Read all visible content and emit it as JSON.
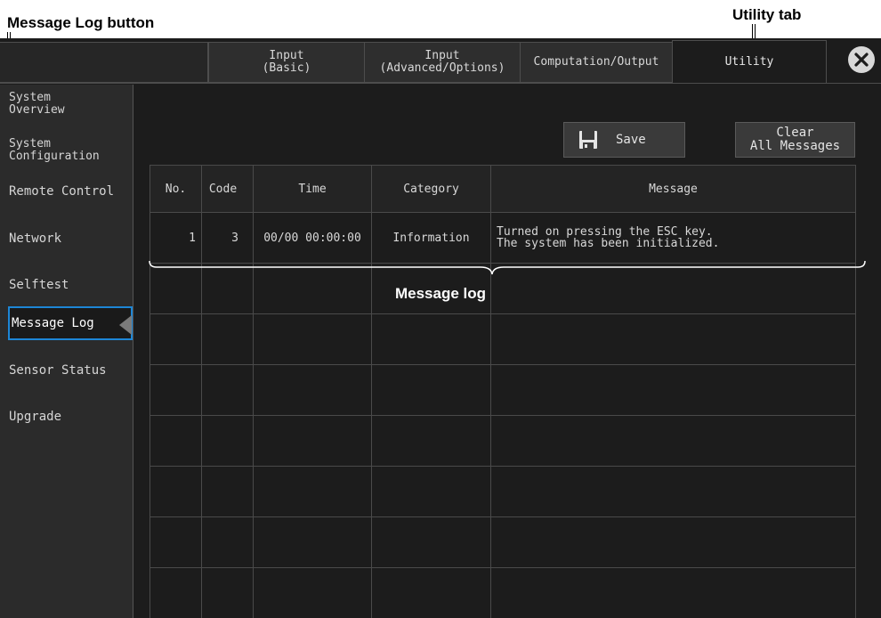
{
  "callouts": {
    "message_log_button": "Message Log button",
    "utility_tab": "Utility tab",
    "message_log": "Message log"
  },
  "tabs": [
    {
      "label": "Input\n(Basic)",
      "active": false
    },
    {
      "label": "Input\n(Advanced/Options)",
      "active": false
    },
    {
      "label": "Computation/Output",
      "active": false
    },
    {
      "label": "Utility",
      "active": true
    }
  ],
  "sidebar": {
    "items": [
      {
        "label": "System\nOverview"
      },
      {
        "label": "System\nConfiguration"
      },
      {
        "label": "Remote Control"
      },
      {
        "label": "Network"
      },
      {
        "label": "Selftest"
      },
      {
        "label": "Message Log",
        "active": true
      },
      {
        "label": "Sensor Status"
      },
      {
        "label": "Upgrade"
      }
    ]
  },
  "toolbar": {
    "save_label": "Save",
    "clear_label": "Clear\nAll Messages"
  },
  "table": {
    "columns": [
      "No.",
      "Code",
      "Time",
      "Category",
      "Message"
    ],
    "rows": [
      {
        "no": "1",
        "code": "3",
        "time": "00/00 00:00:00",
        "category": "Information",
        "message": "Turned on pressing the ESC key.\nThe system has been initialized."
      }
    ]
  },
  "colors": {
    "background": "#1c1c1c",
    "active_highlight": "#1d86d6"
  }
}
